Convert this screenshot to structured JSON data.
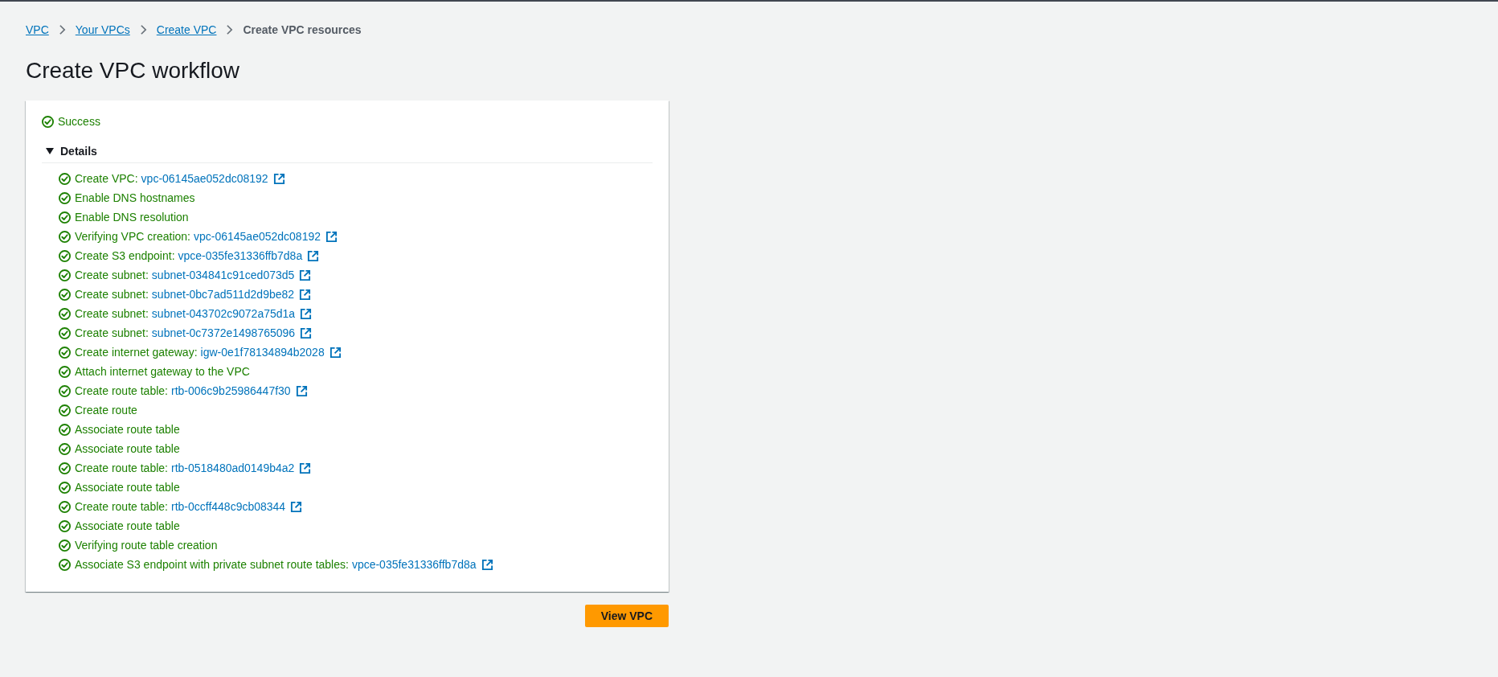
{
  "breadcrumbs": [
    {
      "label": "VPC",
      "kind": "link"
    },
    {
      "label": "Your VPCs",
      "kind": "link"
    },
    {
      "label": "Create VPC",
      "kind": "link"
    },
    {
      "label": "Create VPC resources",
      "kind": "current"
    }
  ],
  "title": "Create VPC workflow",
  "status": {
    "label": "Success"
  },
  "details": {
    "label": "Details",
    "expanded": true,
    "steps": [
      {
        "label": "Create VPC:",
        "resource": "vpc-06145ae052dc08192"
      },
      {
        "label": "Enable DNS hostnames"
      },
      {
        "label": "Enable DNS resolution"
      },
      {
        "label": "Verifying VPC creation:",
        "resource": "vpc-06145ae052dc08192"
      },
      {
        "label": "Create S3 endpoint:",
        "resource": "vpce-035fe31336ffb7d8a"
      },
      {
        "label": "Create subnet:",
        "resource": "subnet-034841c91ced073d5"
      },
      {
        "label": "Create subnet:",
        "resource": "subnet-0bc7ad511d2d9be82"
      },
      {
        "label": "Create subnet:",
        "resource": "subnet-043702c9072a75d1a"
      },
      {
        "label": "Create subnet:",
        "resource": "subnet-0c7372e1498765096"
      },
      {
        "label": "Create internet gateway:",
        "resource": "igw-0e1f78134894b2028"
      },
      {
        "label": "Attach internet gateway to the VPC"
      },
      {
        "label": "Create route table:",
        "resource": "rtb-006c9b25986447f30"
      },
      {
        "label": "Create route"
      },
      {
        "label": "Associate route table"
      },
      {
        "label": "Associate route table"
      },
      {
        "label": "Create route table:",
        "resource": "rtb-0518480ad0149b4a2"
      },
      {
        "label": "Associate route table"
      },
      {
        "label": "Create route table:",
        "resource": "rtb-0ccff448c9cb08344"
      },
      {
        "label": "Associate route table"
      },
      {
        "label": "Verifying route table creation"
      },
      {
        "label": "Associate S3 endpoint with private subnet route tables:",
        "resource": "vpce-035fe31336ffb7d8a"
      }
    ]
  },
  "buttons": [
    {
      "label": "View VPC"
    }
  ]
}
